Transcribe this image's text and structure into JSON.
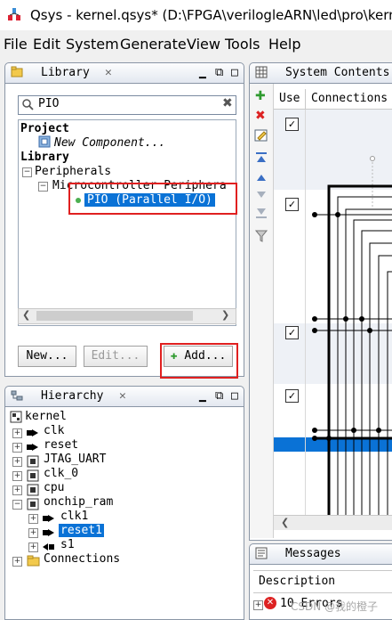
{
  "window": {
    "title": "Qsys - kernel.qsys* (D:\\FPGA\\verilogleARN\\led\\pro\\kerne"
  },
  "menu": [
    "File",
    "Edit",
    "System",
    "Generate",
    "View",
    "Tools",
    "Help"
  ],
  "library": {
    "title": "Library",
    "search_value": "PIO",
    "project_label": "Project",
    "new_component": "New Component...",
    "library_label": "Library",
    "peripherals": "Peripherals",
    "microcontroller": "Microcontroller Periphera",
    "selected": "PIO (Parallel I/O)",
    "btn_new": "New...",
    "btn_edit": "Edit...",
    "btn_add": "Add..."
  },
  "hierarchy": {
    "title": "Hierarchy",
    "items": [
      "kernel",
      "clk",
      "reset",
      "JTAG_UART",
      "clk_0",
      "cpu",
      "onchip_ram",
      "clk1",
      "reset1",
      "s1",
      "Connections"
    ]
  },
  "system_contents": {
    "title": "System Contents",
    "col_use": "Use",
    "col_connections": "Connections"
  },
  "messages": {
    "title": "Messages",
    "col_description": "Description",
    "errors": "10 Errors",
    "watermark": "CSDN @我的橙子"
  },
  "colors": {
    "selection": "#0a72d6",
    "highlight_box": "#e02020"
  }
}
